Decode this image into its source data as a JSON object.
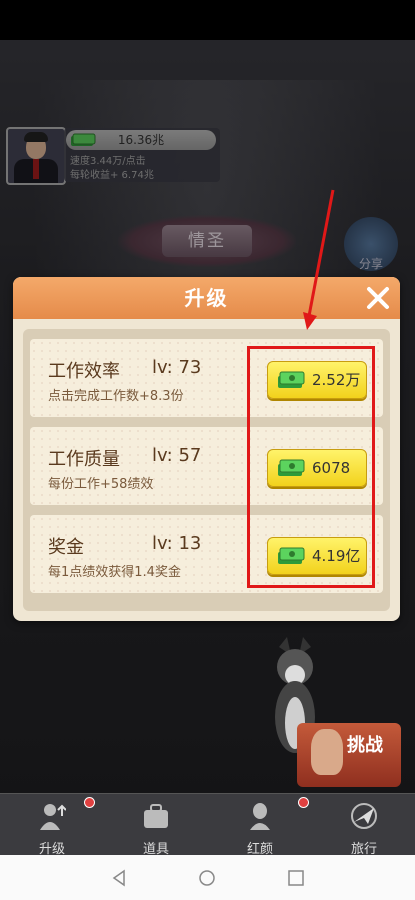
{
  "hud": {
    "money": "16.36兆",
    "speed_text": "速度3.44万/点击",
    "round_income_text": "每轮收益+ 6.74兆"
  },
  "title_banner": "情圣",
  "share_label": "分享",
  "modal": {
    "title": "升级",
    "rows": [
      {
        "name": "工作效率",
        "level": "lv:  73",
        "desc": "点击完成工作数+8.3份",
        "price": "2.52万"
      },
      {
        "name": "工作质量",
        "level": "lv:  57",
        "desc": "每份工作+58绩效",
        "price": "6078"
      },
      {
        "name": "奖金",
        "level": "lv:  13",
        "desc": "每1点绩效获得1.4奖金",
        "price": "4.19亿"
      }
    ]
  },
  "challenge_label": "挑战",
  "bottom_nav": [
    {
      "label": "升级",
      "icon": "upgrade-person-icon",
      "badge": true
    },
    {
      "label": "道具",
      "icon": "briefcase-icon",
      "badge": false
    },
    {
      "label": "红颜",
      "icon": "lady-silhouette-icon",
      "badge": true
    },
    {
      "label": "旅行",
      "icon": "airplane-globe-icon",
      "badge": false
    }
  ],
  "colors": {
    "annotation_red": "#e01818",
    "modal_header": "#e58b4a",
    "button_yellow": "#f2d21c"
  }
}
